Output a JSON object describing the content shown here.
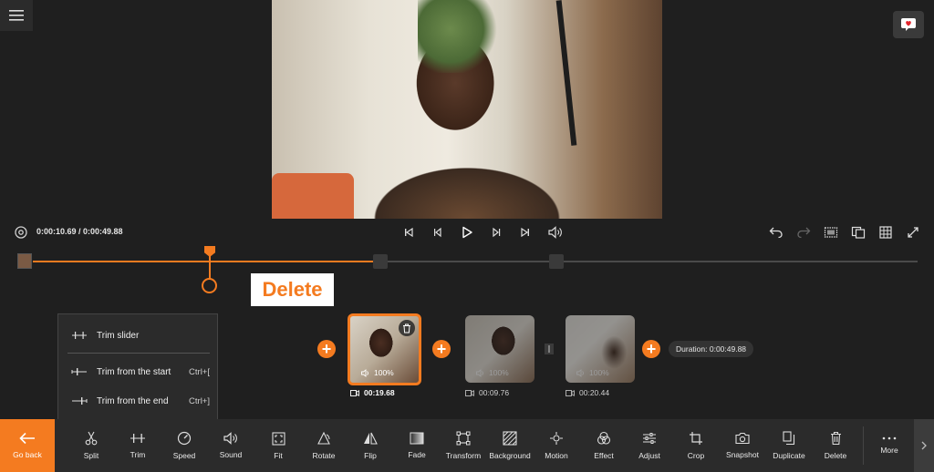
{
  "player": {
    "timecode": "0:00:10.69 / 0:00:49.88"
  },
  "callout": {
    "text": "Delete"
  },
  "trim_menu": {
    "items": [
      {
        "label": "Trim slider",
        "shortcut": ""
      },
      {
        "label": "Trim from the start",
        "shortcut": "Ctrl+["
      },
      {
        "label": "Trim from the end",
        "shortcut": "Ctrl+]"
      }
    ]
  },
  "clips": [
    {
      "volume": "100%",
      "duration": "00:19.68",
      "selected": true
    },
    {
      "volume": "100%",
      "duration": "00:09.76",
      "selected": false
    },
    {
      "volume": "100%",
      "duration": "00:20.44",
      "selected": false
    }
  ],
  "total_duration": "Duration: 0:00:49.88",
  "toolbar": {
    "go_back": "Go back",
    "tools": [
      "Split",
      "Trim",
      "Speed",
      "Sound",
      "Fit",
      "Rotate",
      "Flip",
      "Fade",
      "Transform",
      "Background",
      "Motion",
      "Effect",
      "Adjust",
      "Crop",
      "Snapshot",
      "Duplicate",
      "Delete",
      "More"
    ]
  },
  "colors": {
    "accent": "#f47b20",
    "background": "#1f1f1f",
    "toolbar": "#2b2b2b"
  }
}
